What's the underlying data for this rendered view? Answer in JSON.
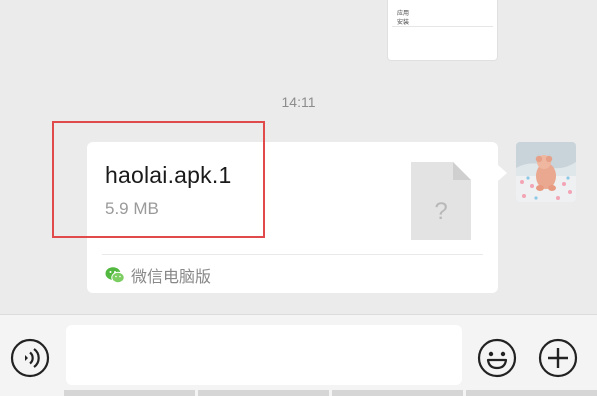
{
  "previous_message": {
    "lines": [
      "应用",
      "安装"
    ]
  },
  "chat": {
    "timestamp": "14:11"
  },
  "file_message": {
    "file_name": "haolai.apk.1",
    "file_size": "5.9 MB",
    "file_icon": "unknown-file-icon",
    "file_icon_glyph": "?",
    "source_label": "微信电脑版",
    "source_icon": "wechat-icon"
  },
  "input_bar": {
    "text_value": "",
    "voice_icon": "voice-icon",
    "emoji_icon": "emoji-icon",
    "plus_icon": "plus-icon"
  },
  "colors": {
    "background": "#ebebeb",
    "bubble": "#ffffff",
    "highlight": "#e04a4a",
    "wechat_green": "#52b83f"
  }
}
